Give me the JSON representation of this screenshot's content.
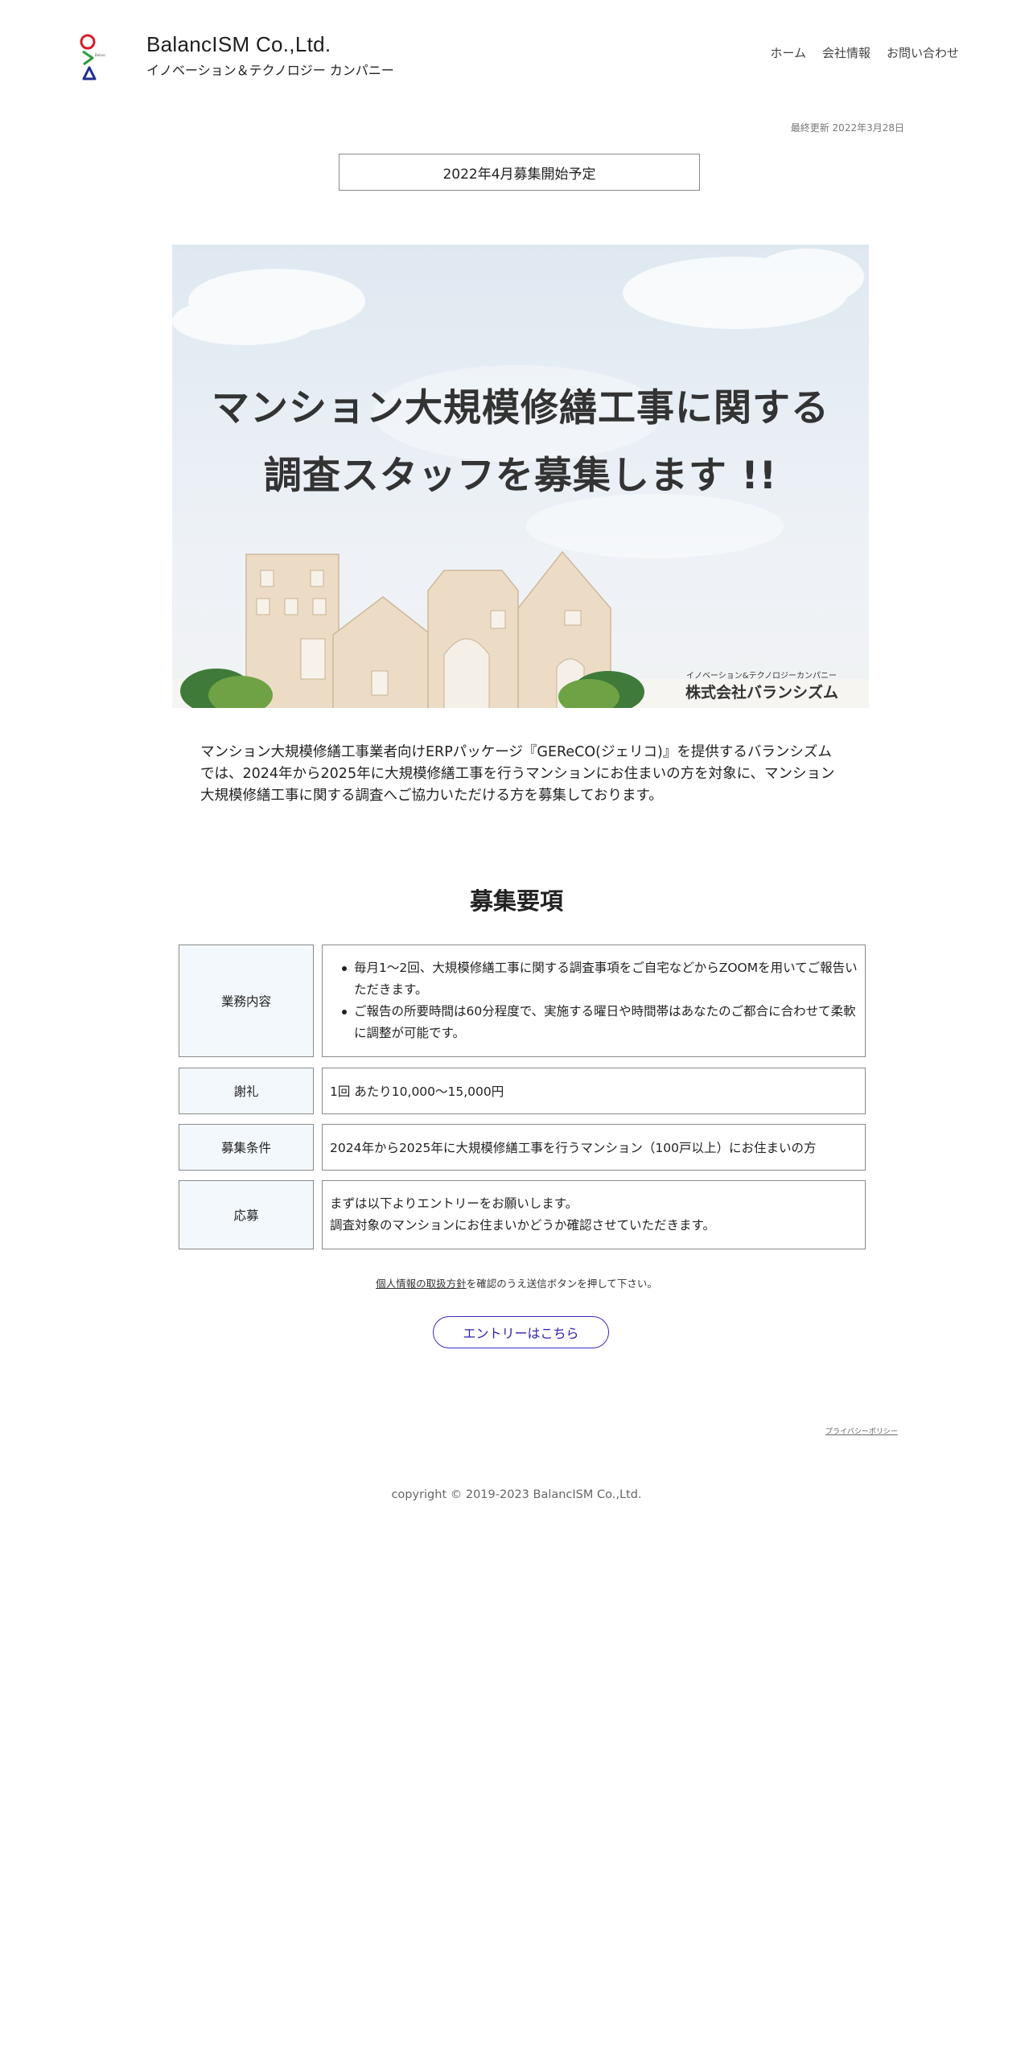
{
  "header": {
    "brand_name": "BalancISM Co.,Ltd.",
    "tagline": "イノベーション＆テクノロジー カンパニー",
    "nav": [
      {
        "label": "ホーム"
      },
      {
        "label": "会社情報"
      },
      {
        "label": "お問い合わせ"
      }
    ]
  },
  "updated": "最終更新 2022年3月28日",
  "badge": "2022年4月募集開始予定",
  "hero": {
    "headline_line1": "マンション大規模修繕工事に関する",
    "headline_line2": "調査スタッフを募集します !!",
    "company_sub": "イノベーション&テクノロジーカンパニー",
    "company_name": "株式会社バランシズム"
  },
  "intro": "マンション大規模修繕工事業者向けERPパッケージ『GEReCO(ジェリコ)』を提供するバランシズムでは、2024年から2025年に大規模修繕工事を行うマンションにお住まいの方を対象に、マンション大規模修繕工事に関する調査へご協力いただける方を募集しております。",
  "requirements": {
    "title": "募集要項",
    "rows": [
      {
        "label": "業務内容",
        "items": [
          "毎月1〜2回、大規模修繕工事に関する調査事項をご自宅などからZOOMを用いてご報告いただきます。",
          "ご報告の所要時間は60分程度で、実施する曜日や時間帯はあなたのご都合に合わせて柔軟に調整が可能です。"
        ]
      },
      {
        "label": "謝礼",
        "text": "1回 あたり10,000〜15,000円"
      },
      {
        "label": "募集条件",
        "text": "2024年から2025年に大規模修繕工事を行うマンション（100戸以上）にお住まいの方"
      },
      {
        "label": "応募",
        "lines": [
          "まずは以下よりエントリーをお願いします。",
          "調査対象のマンションにお住まいかどうか確認させていただきます。"
        ]
      }
    ]
  },
  "consent": {
    "link": "個人情報の取扱方針",
    "text": "を確認のうえ送信ボタンを押して下さい。"
  },
  "entry_button": "エントリーはこちら",
  "footer": {
    "privacy": "プライバシーポリシー",
    "copyright": "copyright © 2019-2023 BalancISM Co.,Ltd."
  },
  "colors": {
    "label_bg": "#f3f8fc",
    "border": "#8a8a8a",
    "button_accent": "#3b2cc4"
  }
}
